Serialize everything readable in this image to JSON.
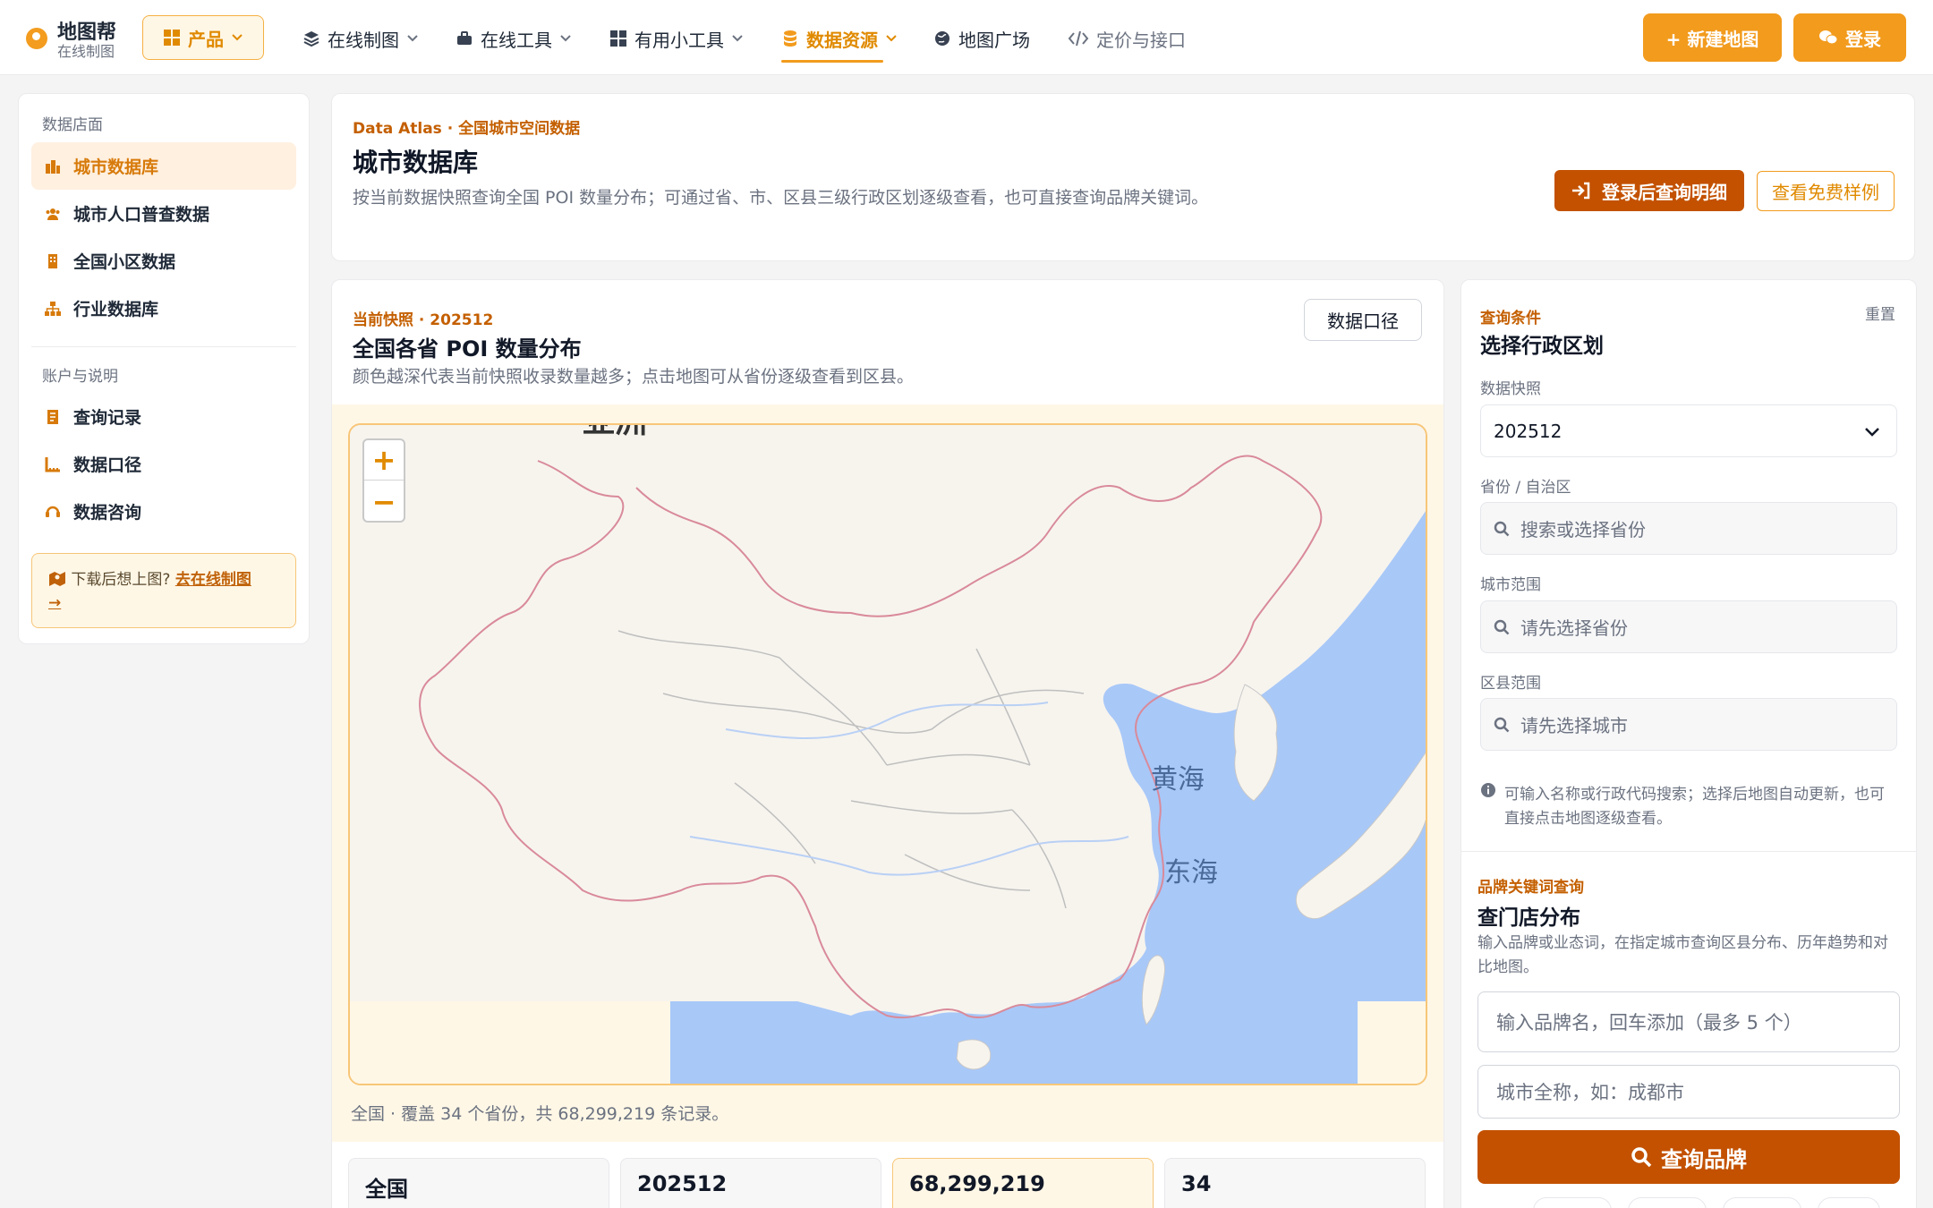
{
  "brand": {
    "name": "地图帮",
    "sub": "在线制图"
  },
  "nav": {
    "product": "产品",
    "items": [
      {
        "label": "在线制图",
        "icon": "layers-icon"
      },
      {
        "label": "在线工具",
        "icon": "toolbox-icon"
      },
      {
        "label": "有用小工具",
        "icon": "grid-icon"
      },
      {
        "label": "数据资源",
        "icon": "database-icon",
        "active": true
      },
      {
        "label": "地图广场",
        "icon": "globe-icon"
      },
      {
        "label": "定价与接口",
        "icon": "code-icon"
      }
    ],
    "new_map": "+ 新建地图",
    "login": "登录"
  },
  "sidebar": {
    "section1": "数据店面",
    "items1": [
      "城市数据库",
      "城市人口普查数据",
      "全国小区数据",
      "行业数据库"
    ],
    "section2": "账户与说明",
    "items2": [
      "查询记录",
      "数据口径",
      "数据咨询"
    ],
    "promo_text": "下载后想上图?",
    "promo_link": "去在线制图",
    "promo_arrow": "→"
  },
  "header": {
    "eyebrow": "Data Atlas · 全国城市空间数据",
    "title": "城市数据库",
    "desc": "按当前数据快照查询全国 POI 数量分布；可通过省、市、区县三级行政区划逐级查看，也可直接查询品牌关键词。",
    "btn_login_query": "登录后查询明细",
    "btn_sample": "查看免费样例"
  },
  "map_panel": {
    "eyebrow": "当前快照 · 202512",
    "title": "全国各省 POI 数量分布",
    "desc": "颜色越深代表当前快照收录数量越多；点击地图可从省份逐级查看到区县。",
    "btn_caliber": "数据口径",
    "zoom_in": "+",
    "zoom_out": "−",
    "labels": {
      "yellow_sea": "黄海",
      "east_sea": "东海",
      "top_cut": "亚洲"
    },
    "caption": "全国 · 覆盖 34 个省份，共 68,299,219 条记录。"
  },
  "stats": [
    "全国",
    "202512",
    "68,299,219",
    "34"
  ],
  "query": {
    "eyebrow": "查询条件",
    "title": "选择行政区划",
    "reset": "重置",
    "snapshot_label": "数据快照",
    "snapshot_value": "202512",
    "province_label": "省份 / 自治区",
    "province_ph": "搜索或选择省份",
    "city_label": "城市范围",
    "city_ph": "请先选择省份",
    "district_label": "区县范围",
    "district_ph": "请先选择城市",
    "hint": "可输入名称或行政代码搜索；选择后地图自动更新，也可直接点击地图逐级查看。"
  },
  "brand_query": {
    "eyebrow": "品牌关键词查询",
    "title": "查门店分布",
    "desc": "输入品牌或业态词，在指定城市查询区县分布、历年趋势和对比地图。",
    "brand_ph": "输入品牌名，回车添加（最多 5 个）",
    "city_ph": "城市全称，如：成都市",
    "btn": "查询品牌"
  },
  "colors": {
    "accent": "#f29b1d",
    "dark_accent": "#c35100",
    "sea": "#a8c8f8",
    "border_line": "#d98a9a"
  }
}
